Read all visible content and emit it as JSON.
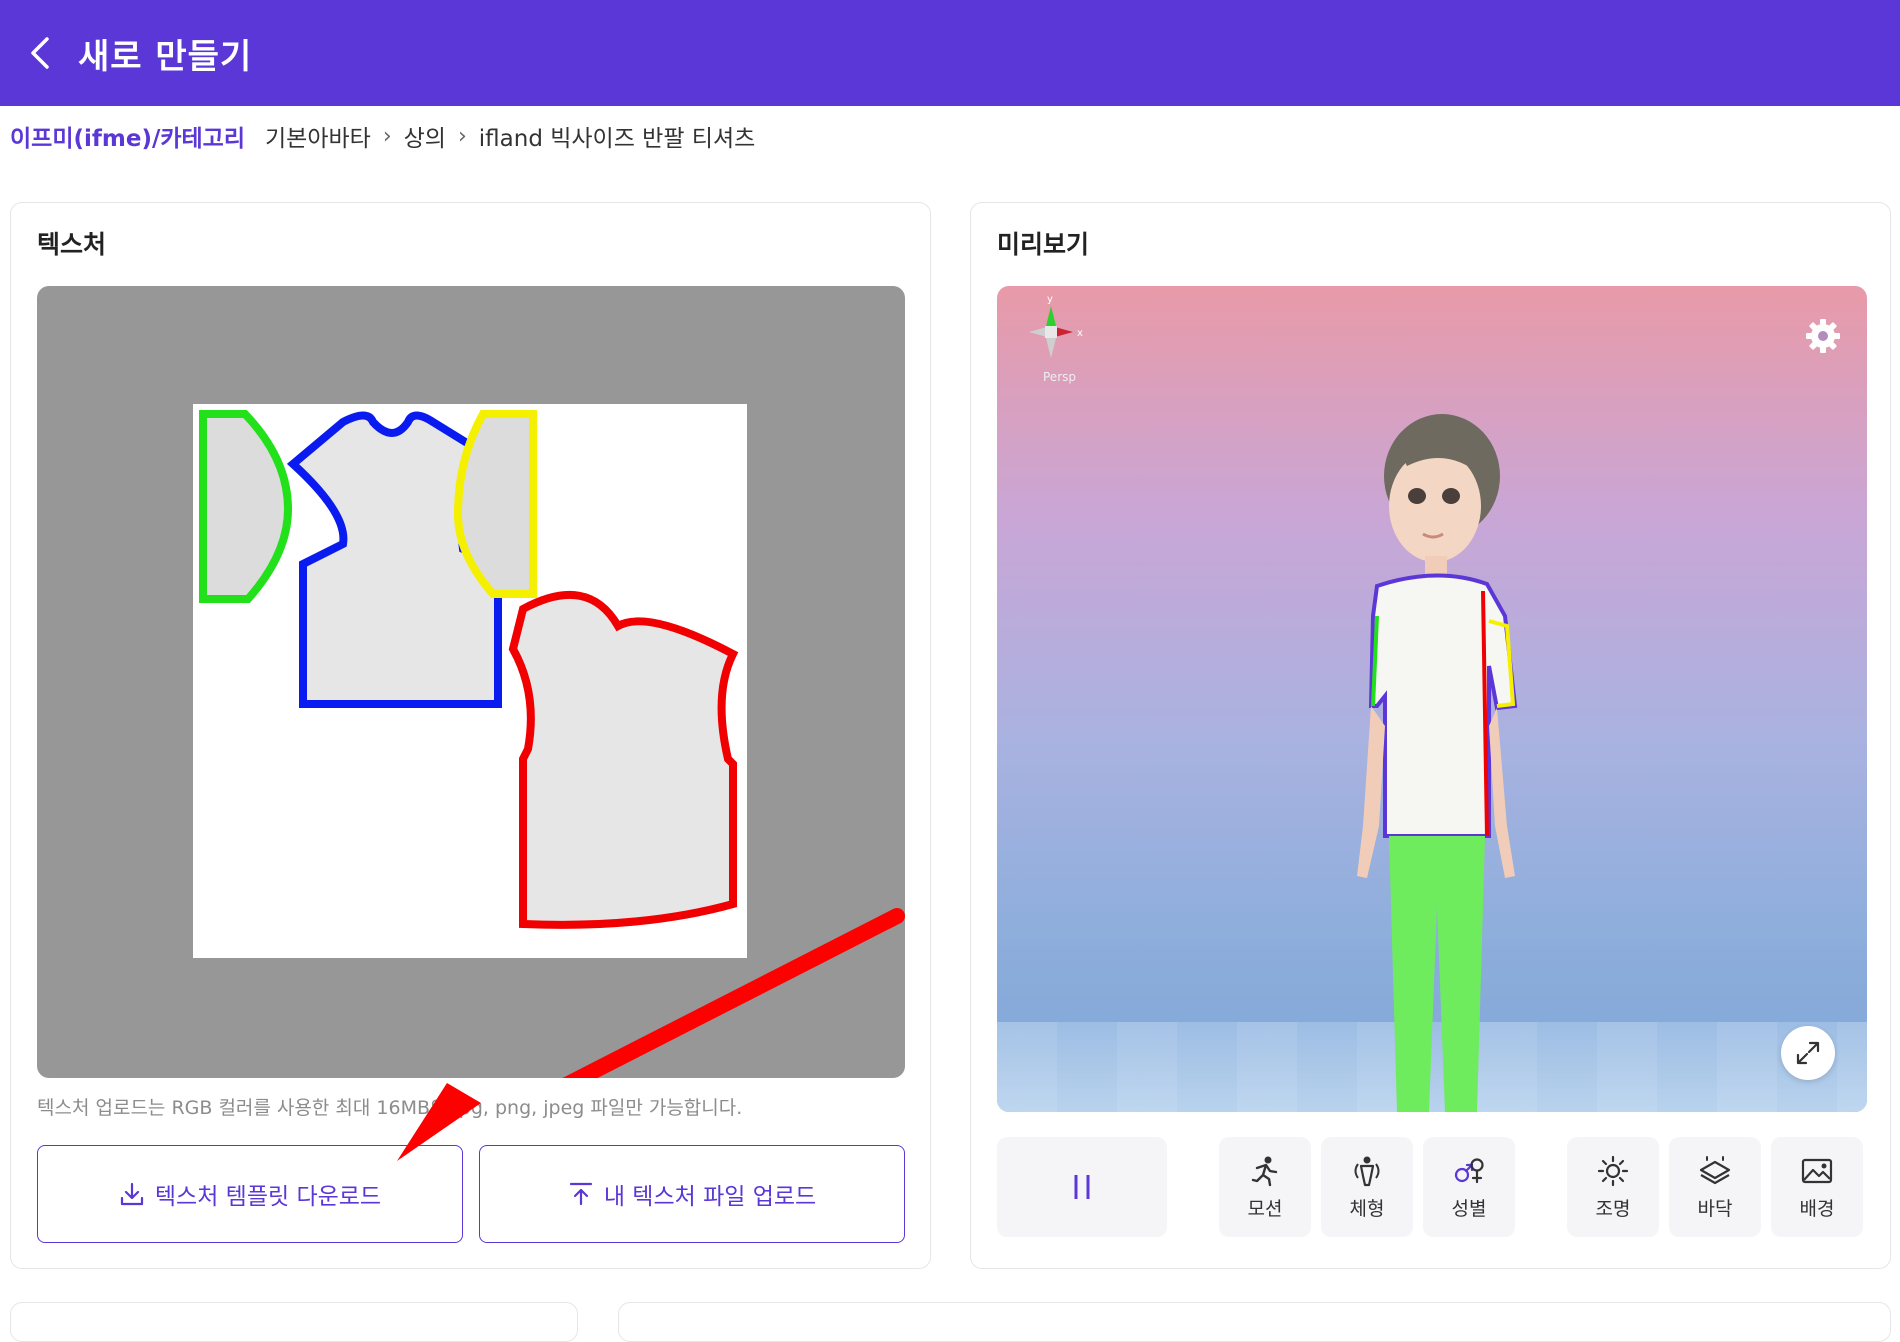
{
  "header": {
    "title": "새로 만들기",
    "back_icon": "chevron-left-icon",
    "background": "#5a37d6"
  },
  "breadcrumb": {
    "root": "이프미(ifme)/카테고리",
    "items": [
      "기본아바타",
      "상의",
      "ifland 빅사이즈 반팔 티셔츠"
    ]
  },
  "texture_panel": {
    "title": "텍스처",
    "hint": "텍스처 업로드는 RGB 컬러를 사용한 최대 16MB의 jpg, png, jpeg 파일만 가능합니다.",
    "download_button": "텍스처 템플릿 다운로드",
    "upload_button": "내 텍스처 파일 업로드"
  },
  "preview_panel": {
    "title": "미리보기",
    "gizmo_label": "Persp",
    "gizmo_axes": {
      "y": "y",
      "x": "x"
    },
    "controls": [
      {
        "label": "모션",
        "icon": "motion-icon"
      },
      {
        "label": "체형",
        "icon": "body-type-icon"
      },
      {
        "label": "성별",
        "icon": "gender-icon"
      },
      {
        "label": "조명",
        "icon": "lighting-icon"
      },
      {
        "label": "바닥",
        "icon": "floor-icon"
      },
      {
        "label": "배경",
        "icon": "background-image-icon"
      }
    ],
    "pause_icon": "pause-icon"
  },
  "colors": {
    "accent": "#5a37d6",
    "uv_green": "#22e01a",
    "uv_blue": "#0a1bf0",
    "uv_yellow": "#f5f000",
    "uv_red": "#f00000",
    "annotation_arrow": "#ff0000"
  }
}
